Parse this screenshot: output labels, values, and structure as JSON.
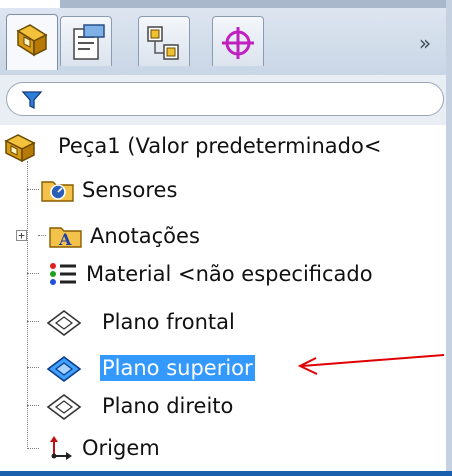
{
  "header": {
    "tabs": [
      {
        "icon": "feature-manager-icon",
        "active": true
      },
      {
        "icon": "property-manager-icon",
        "active": false
      },
      {
        "icon": "configuration-manager-icon",
        "active": false
      },
      {
        "icon": "dimxpert-manager-icon",
        "active": false
      }
    ],
    "more_label": "»"
  },
  "filter": {
    "icon": "filter-icon",
    "value": ""
  },
  "tree": {
    "root": {
      "label": "Peça1  (Valor predeterminado<",
      "icon": "part-icon"
    },
    "items": [
      {
        "label": "Sensores",
        "icon": "sensors-folder-icon",
        "expandable": false
      },
      {
        "label": "Anotações",
        "icon": "annotations-folder-icon",
        "expandable": true
      },
      {
        "label": "Material <não especificado",
        "icon": "material-icon",
        "expandable": false
      },
      {
        "label": "Plano frontal",
        "icon": "plane-icon",
        "expandable": false
      },
      {
        "label": "Plano superior",
        "icon": "plane-selected-icon",
        "expandable": false,
        "selected": true
      },
      {
        "label": "Plano direito",
        "icon": "plane-icon",
        "expandable": false
      },
      {
        "label": "Origem",
        "icon": "origin-icon",
        "expandable": false
      }
    ]
  },
  "colors": {
    "selection": "#3399ff",
    "arrow": "#e00000",
    "accent": "#1a5fae"
  }
}
